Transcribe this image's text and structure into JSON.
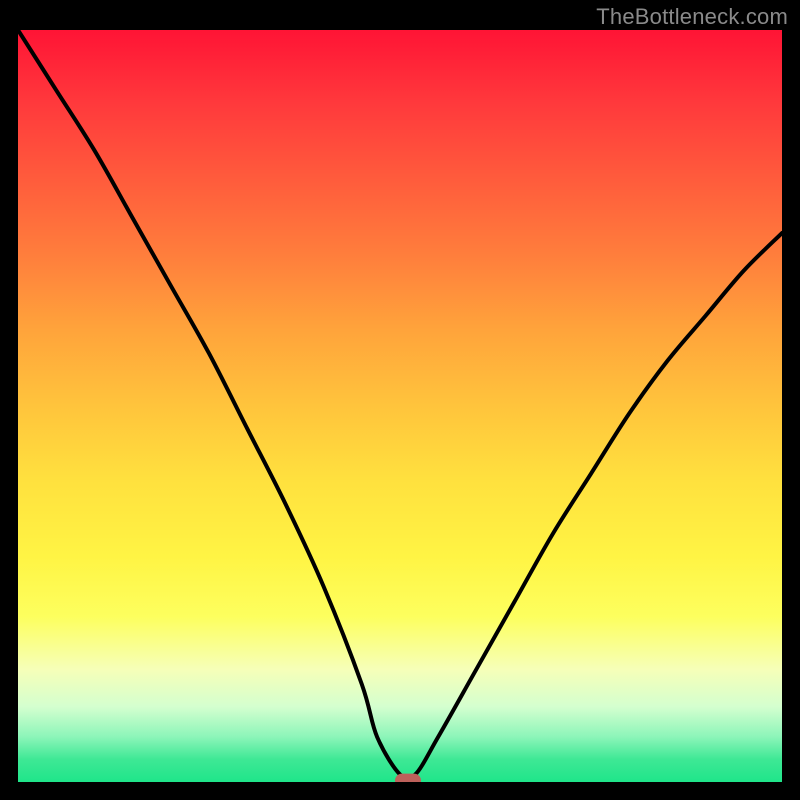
{
  "watermark": "TheBottleneck.com",
  "colors": {
    "frame_bg": "#000000",
    "watermark_text": "#8a8a8a",
    "curve_stroke": "#000000",
    "marker_fill": "#bd615b",
    "gradient_top": "#ff1435",
    "gradient_bottom": "#1fe58a"
  },
  "chart_data": {
    "type": "line",
    "title": "",
    "xlabel": "",
    "ylabel": "",
    "xlim": [
      0,
      100
    ],
    "ylim": [
      0,
      100
    ],
    "grid": false,
    "legend": false,
    "series": [
      {
        "name": "bottleneck-curve",
        "x": [
          0,
          5,
          10,
          15,
          20,
          25,
          30,
          35,
          40,
          45,
          47,
          50,
          52,
          55,
          60,
          65,
          70,
          75,
          80,
          85,
          90,
          95,
          100
        ],
        "values": [
          100,
          92,
          84,
          75,
          66,
          57,
          47,
          37,
          26,
          13,
          6,
          1,
          1,
          6,
          15,
          24,
          33,
          41,
          49,
          56,
          62,
          68,
          73
        ]
      }
    ],
    "marker": {
      "x": 51,
      "y": 0
    },
    "annotations": []
  }
}
